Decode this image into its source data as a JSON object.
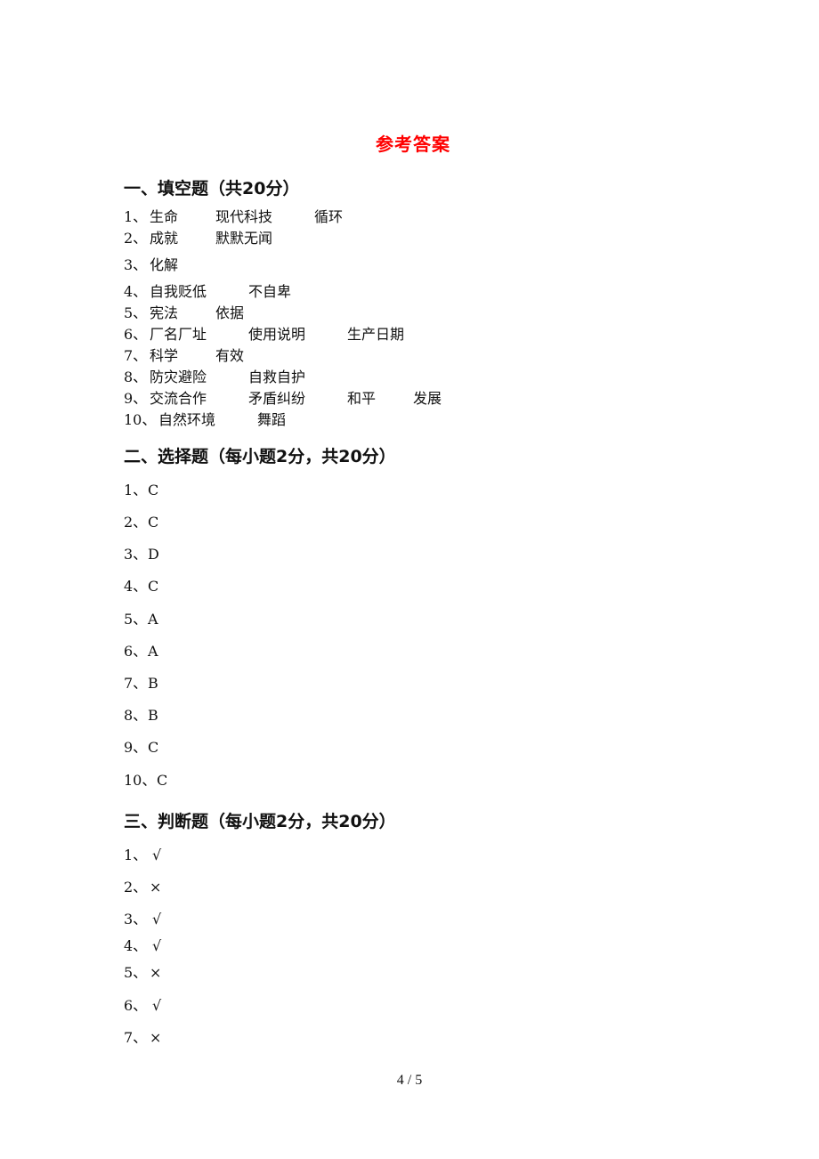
{
  "title": "参考答案",
  "sections": [
    {
      "heading": "一、填空题（共20分）",
      "items": [
        {
          "num": "1、",
          "answers": [
            "生命",
            "现代科技",
            "循环"
          ]
        },
        {
          "num": "2、",
          "answers": [
            "成就",
            "默默无闻"
          ]
        },
        {
          "num": "3、",
          "answers": [
            "化解"
          ]
        },
        {
          "num": "4、",
          "answers": [
            "自我贬低",
            "不自卑"
          ]
        },
        {
          "num": "5、",
          "answers": [
            "宪法",
            "依据"
          ]
        },
        {
          "num": "6、",
          "answers": [
            "厂名厂址",
            "使用说明",
            "生产日期"
          ]
        },
        {
          "num": "7、",
          "answers": [
            "科学",
            "有效"
          ]
        },
        {
          "num": "8、",
          "answers": [
            "防灾避险",
            "自救自护"
          ]
        },
        {
          "num": "9、",
          "answers": [
            "交流合作",
            "矛盾纠纷",
            "和平",
            "发展"
          ]
        },
        {
          "num": "10、",
          "answers": [
            "自然环境",
            "舞蹈"
          ]
        }
      ]
    },
    {
      "heading": "二、选择题（每小题2分，共20分）",
      "items": [
        {
          "num": "1、",
          "answer": "C"
        },
        {
          "num": "2、",
          "answer": "C"
        },
        {
          "num": "3、",
          "answer": "D"
        },
        {
          "num": "4、",
          "answer": "C"
        },
        {
          "num": "5、",
          "answer": "A"
        },
        {
          "num": "6、",
          "answer": "A"
        },
        {
          "num": "7、",
          "answer": "B"
        },
        {
          "num": "8、",
          "answer": "B"
        },
        {
          "num": "9、",
          "answer": "C"
        },
        {
          "num": "10、",
          "answer": "C"
        }
      ]
    },
    {
      "heading": "三、判断题（每小题2分，共20分）",
      "items": [
        {
          "num": "1、",
          "answer": "√"
        },
        {
          "num": "2、",
          "answer": "×"
        },
        {
          "num": "3、",
          "answer": "√"
        },
        {
          "num": "4、",
          "answer": "√"
        },
        {
          "num": "5、",
          "answer": "×"
        },
        {
          "num": "6、",
          "answer": "√"
        },
        {
          "num": "7、",
          "answer": "×"
        }
      ]
    }
  ],
  "footer": {
    "page_number": "4 / 5"
  }
}
